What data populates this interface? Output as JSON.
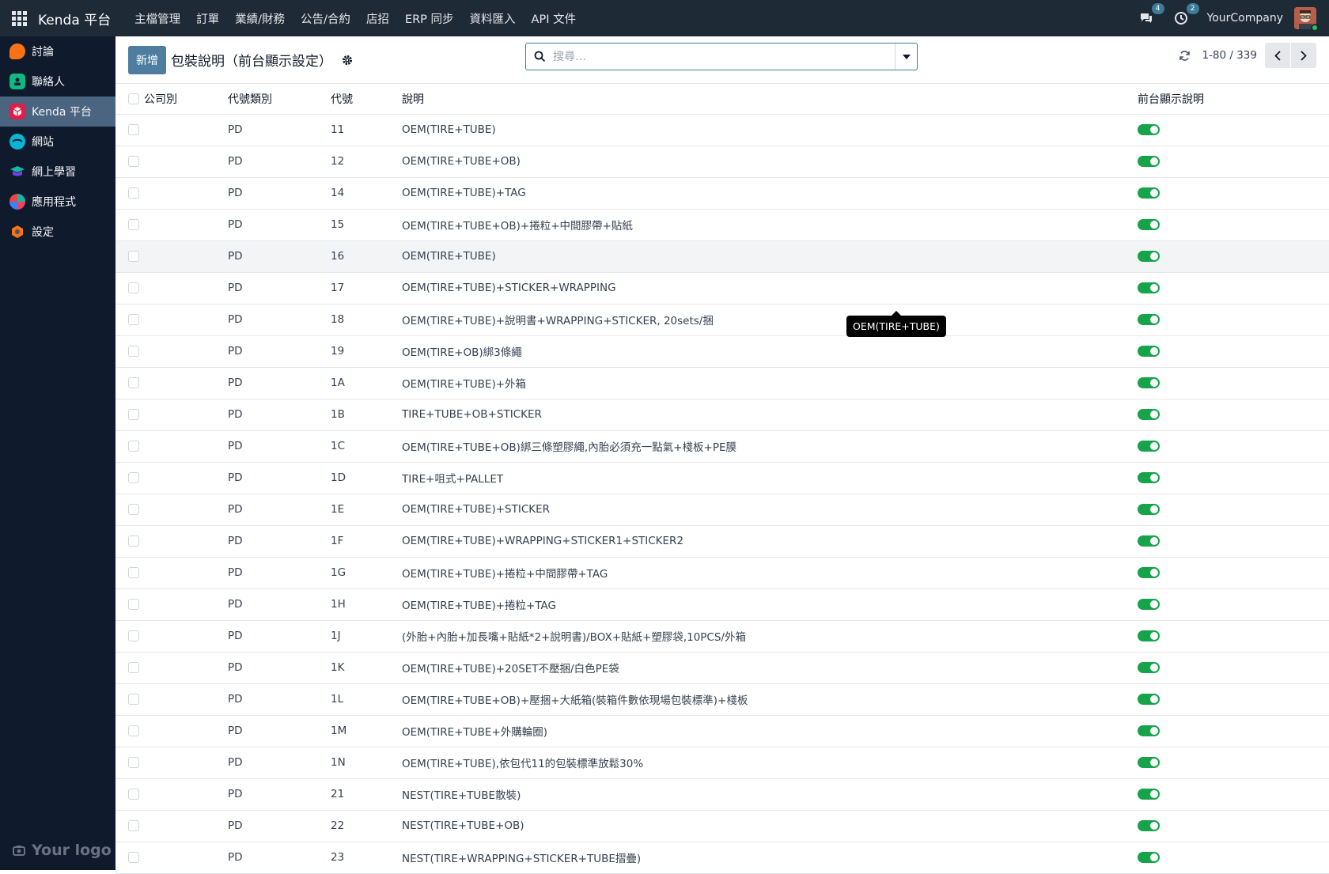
{
  "navbar": {
    "brand": "Kenda 平台",
    "menu": [
      "主檔管理",
      "訂單",
      "業績/財務",
      "公告/合約",
      "店招",
      "ERP 同步",
      "資料匯入",
      "API 文件"
    ],
    "messages_badge": "4",
    "activity_badge": "2",
    "company": "YourCompany"
  },
  "sidebar": {
    "items": [
      {
        "label": "討論",
        "icon": "discuss-icon",
        "color": "#f97316"
      },
      {
        "label": "聯絡人",
        "icon": "contacts-icon",
        "color": "#10b981"
      },
      {
        "label": "Kenda 平台",
        "icon": "cube-icon",
        "color": "#e11d48"
      },
      {
        "label": "網站",
        "icon": "website-icon",
        "color": "#06b6d4"
      },
      {
        "label": "網上學習",
        "icon": "elearning-icon",
        "color": "#14b8a6"
      },
      {
        "label": "應用程式",
        "icon": "apps-icon",
        "color": "#ef4444"
      },
      {
        "label": "設定",
        "icon": "settings-icon",
        "color": "#f97316"
      }
    ],
    "active_index": 2,
    "logo_text": "Your logo"
  },
  "control": {
    "new_label": "新增",
    "title": "包裝說明（前台顯示設定）",
    "search_placeholder": "搜尋…",
    "pager_value": "1-80 / 339"
  },
  "table": {
    "columns": [
      "公司別",
      "代號類別",
      "代號",
      "說明",
      "前台顯示說明"
    ],
    "rows": [
      {
        "company": "",
        "type": "PD",
        "code": "11",
        "desc": "OEM(TIRE+TUBE)",
        "show": true
      },
      {
        "company": "",
        "type": "PD",
        "code": "12",
        "desc": "OEM(TIRE+TUBE+OB)",
        "show": true
      },
      {
        "company": "",
        "type": "PD",
        "code": "14",
        "desc": "OEM(TIRE+TUBE)+TAG",
        "show": true
      },
      {
        "company": "",
        "type": "PD",
        "code": "15",
        "desc": "OEM(TIRE+TUBE+OB)+捲粒+中間膠帶+貼紙",
        "show": true
      },
      {
        "company": "",
        "type": "PD",
        "code": "16",
        "desc": "OEM(TIRE+TUBE)",
        "show": true
      },
      {
        "company": "",
        "type": "PD",
        "code": "17",
        "desc": "OEM(TIRE+TUBE)+STICKER+WRAPPING",
        "show": true
      },
      {
        "company": "",
        "type": "PD",
        "code": "18",
        "desc": "OEM(TIRE+TUBE)+說明書+WRAPPING+STICKER, 20sets/捆",
        "show": true
      },
      {
        "company": "",
        "type": "PD",
        "code": "19",
        "desc": "OEM(TIRE+OB)綁3條繩",
        "show": true
      },
      {
        "company": "",
        "type": "PD",
        "code": "1A",
        "desc": "OEM(TIRE+TUBE)+外箱",
        "show": true
      },
      {
        "company": "",
        "type": "PD",
        "code": "1B",
        "desc": "TIRE+TUBE+OB+STICKER",
        "show": true
      },
      {
        "company": "",
        "type": "PD",
        "code": "1C",
        "desc": "OEM(TIRE+TUBE+OB)綁三條塑膠繩,內胎必須充一點氣+棧板+PE膜",
        "show": true
      },
      {
        "company": "",
        "type": "PD",
        "code": "1D",
        "desc": "TIRE+咀式+PALLET",
        "show": true
      },
      {
        "company": "",
        "type": "PD",
        "code": "1E",
        "desc": "OEM(TIRE+TUBE)+STICKER",
        "show": true
      },
      {
        "company": "",
        "type": "PD",
        "code": "1F",
        "desc": "OEM(TIRE+TUBE)+WRAPPING+STICKER1+STICKER2",
        "show": true
      },
      {
        "company": "",
        "type": "PD",
        "code": "1G",
        "desc": "OEM(TIRE+TUBE)+捲粒+中間膠帶+TAG",
        "show": true
      },
      {
        "company": "",
        "type": "PD",
        "code": "1H",
        "desc": "OEM(TIRE+TUBE)+捲粒+TAG",
        "show": true
      },
      {
        "company": "",
        "type": "PD",
        "code": "1J",
        "desc": "(外胎+內胎+加長嘴+貼紙*2+說明書)/BOX+貼紙+塑膠袋,10PCS/外箱",
        "show": true
      },
      {
        "company": "",
        "type": "PD",
        "code": "1K",
        "desc": "OEM(TIRE+TUBE)+20SET不壓捆/白色PE袋",
        "show": true
      },
      {
        "company": "",
        "type": "PD",
        "code": "1L",
        "desc": "OEM(TIRE+TUBE+OB)+壓捆+大紙箱(裝箱件數依現場包裝標準)+棧板",
        "show": true
      },
      {
        "company": "",
        "type": "PD",
        "code": "1M",
        "desc": "OEM(TIRE+TUBE+外購輪圈)",
        "show": true
      },
      {
        "company": "",
        "type": "PD",
        "code": "1N",
        "desc": "OEM(TIRE+TUBE),依包代11的包裝標準放鬆30%",
        "show": true
      },
      {
        "company": "",
        "type": "PD",
        "code": "21",
        "desc": "NEST(TIRE+TUBE散裝)",
        "show": true
      },
      {
        "company": "",
        "type": "PD",
        "code": "22",
        "desc": "NEST(TIRE+TUBE+OB)",
        "show": true
      },
      {
        "company": "",
        "type": "PD",
        "code": "23",
        "desc": "NEST(TIRE+WRAPPING+STICKER+TUBE摺疊)",
        "show": true
      }
    ],
    "hovered_row": 4
  },
  "tooltip": {
    "text": "OEM(TIRE+TUBE)"
  },
  "colors": {
    "navbar": "#1f2a37",
    "sidebar": "#0f1b2d",
    "accent": "#4e7da0",
    "toggle_on": "#16a34a"
  }
}
